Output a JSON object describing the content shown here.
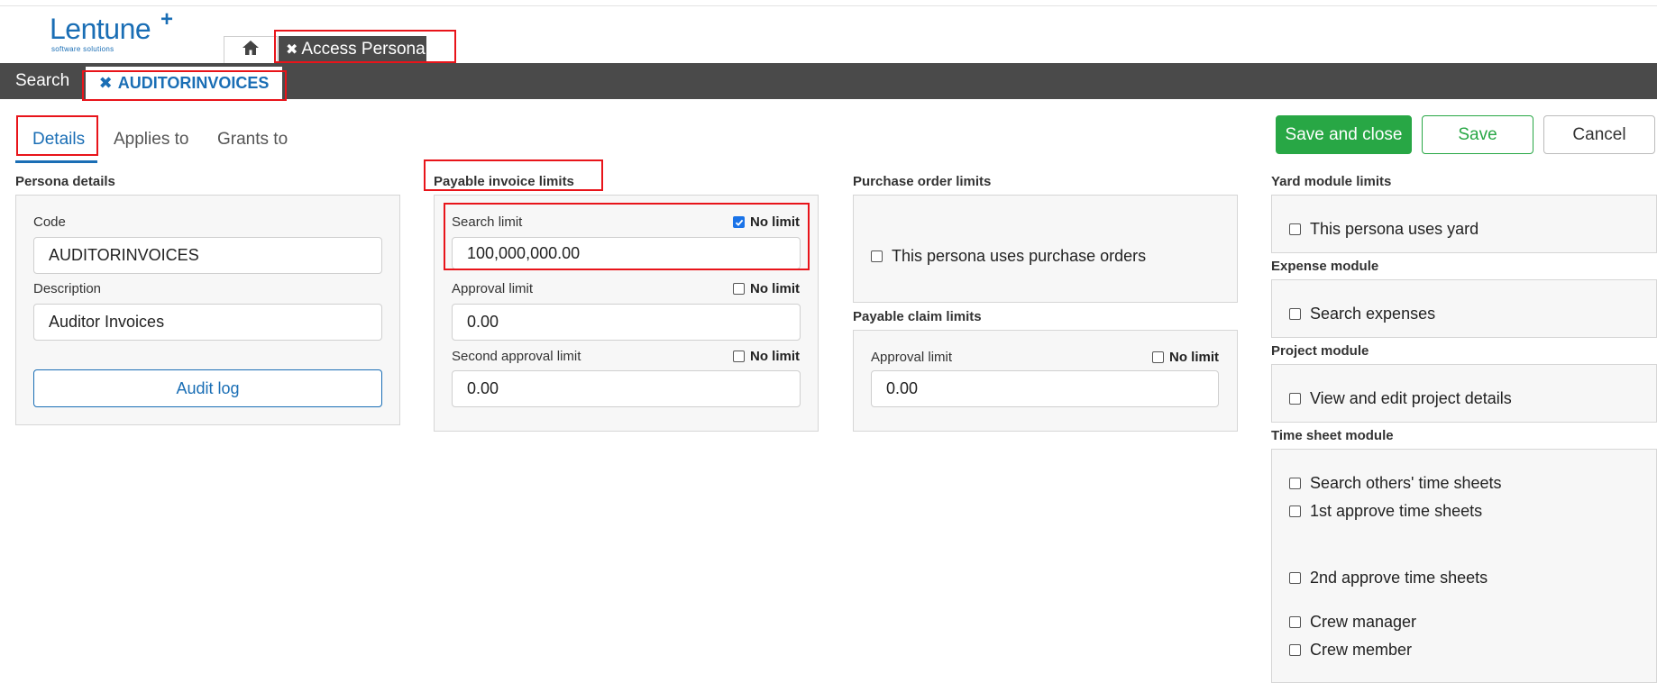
{
  "brand": {
    "name": "Lentune",
    "mark": "+",
    "tagline": "software solutions"
  },
  "top_tabs": {
    "app_tab_label": "Access Persona"
  },
  "nav": {
    "search_label": "Search",
    "record_tab_label": "AUDITORINVOICES"
  },
  "sub_tabs": [
    "Details",
    "Applies to",
    "Grants to"
  ],
  "actions": {
    "save_close": "Save and close",
    "save": "Save",
    "cancel": "Cancel"
  },
  "colors": {
    "brand": "#1a6eb5",
    "primary_green": "#28a745",
    "dark_bar": "#4a4a4a",
    "highlight_red": "#e8141a"
  },
  "persona_details": {
    "title": "Persona details",
    "code_label": "Code",
    "code_value": "AUDITORINVOICES",
    "description_label": "Description",
    "description_value": "Auditor Invoices",
    "audit_log": "Audit log"
  },
  "payable_invoice_limits": {
    "title": "Payable invoice limits",
    "search_limit_label": "Search limit",
    "search_limit_value": "100,000,000.00",
    "search_no_limit": true,
    "approval_limit_label": "Approval limit",
    "approval_limit_value": "0.00",
    "approval_no_limit": false,
    "second_approval_label": "Second approval limit",
    "second_approval_value": "0.00",
    "second_no_limit": false,
    "no_limit_label": "No limit"
  },
  "purchase_order_limits": {
    "title": "Purchase order limits",
    "uses_po_label": "This persona uses purchase orders"
  },
  "payable_claim_limits": {
    "title": "Payable claim limits",
    "approval_limit_label": "Approval limit",
    "approval_limit_value": "0.00",
    "no_limit_label": "No limit"
  },
  "yard_module": {
    "title": "Yard module limits",
    "option": "This persona uses yard"
  },
  "expense_module": {
    "title": "Expense module",
    "option": "Search expenses"
  },
  "project_module": {
    "title": "Project module",
    "option": "View and edit project details"
  },
  "time_sheet_module": {
    "title": "Time sheet module",
    "options": [
      "Search others' time sheets",
      "1st approve time sheets",
      "2nd approve time sheets",
      "Crew manager",
      "Crew member"
    ]
  }
}
